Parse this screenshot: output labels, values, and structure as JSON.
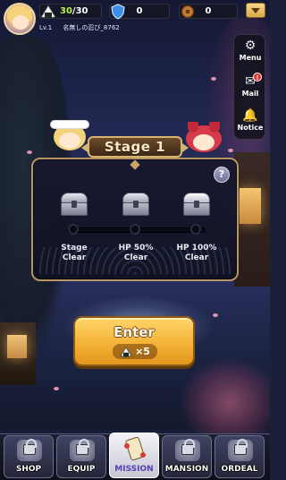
{
  "player": {
    "level": "Lv.1",
    "name": "名無しの忍び_8762"
  },
  "resources": {
    "stamina_current": "30",
    "stamina_max": "/30",
    "gems": "0",
    "coins": "0"
  },
  "side_menu": {
    "menu_label": "Menu",
    "mail_label": "Mail",
    "mail_badge": "!",
    "notice_label": "Notice"
  },
  "stage": {
    "title": "Stage 1",
    "help": "?",
    "rewards": [
      {
        "line1": "Stage",
        "line2": "Clear"
      },
      {
        "line1": "HP 50%",
        "line2": "Clear"
      },
      {
        "line1": "HP 100%",
        "line2": "Clear"
      }
    ]
  },
  "enter_button": {
    "label": "Enter",
    "cost": "×5"
  },
  "bottom_nav": {
    "shop": "SHOP",
    "equip": "EQUIP",
    "mission": "MISSION",
    "mansion": "MANSION",
    "ordeal": "ORDEAL"
  },
  "colors": {
    "accent_gold": "#f3b338",
    "card_border": "#b99563",
    "stamina_highlight": "#b7f04a"
  },
  "icons": {
    "stamina": "onigiri-icon",
    "gems": "blue-shield-gem-icon",
    "coins": "bronze-coin-icon",
    "menu": "gear-icon",
    "mail": "envelope-icon",
    "notice": "bell-icon"
  }
}
